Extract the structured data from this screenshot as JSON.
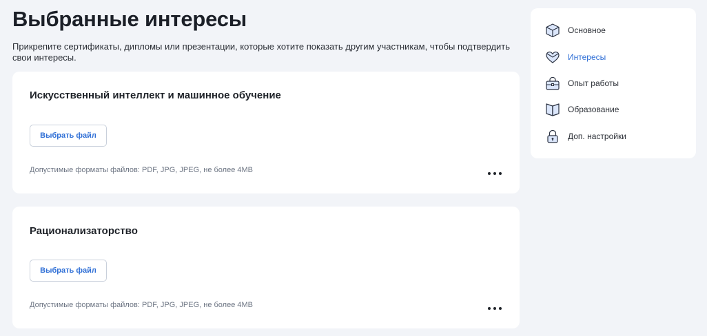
{
  "page": {
    "title": "Выбранные интересы",
    "description": "Прикрепите сертификаты, дипломы или презентации, которые хотите показать другим участникам, чтобы подтвердить свои интересы."
  },
  "cards": [
    {
      "title": "Искусственный интеллект и машинное обучение",
      "button_label": "Выбрать файл",
      "formats": "Допустимые форматы файлов: PDF, JPG, JPEG, не более 4MB"
    },
    {
      "title": "Рационализаторство",
      "button_label": "Выбрать файл",
      "formats": "Допустимые форматы файлов: PDF, JPG, JPEG, не более 4MB"
    }
  ],
  "sidebar": {
    "items": [
      {
        "label": "Основное",
        "icon": "cube-icon",
        "active": false
      },
      {
        "label": "Интересы",
        "icon": "heart-icon",
        "active": true
      },
      {
        "label": "Опыт работы",
        "icon": "briefcase-icon",
        "active": false
      },
      {
        "label": "Образование",
        "icon": "book-icon",
        "active": false
      },
      {
        "label": "Доп. настройки",
        "icon": "lock-icon",
        "active": false
      }
    ]
  },
  "colors": {
    "background": "#f2f4f8",
    "accent": "#2f6fd6",
    "icon_fill": "#dbe6fb",
    "icon_stroke": "#2a3140"
  }
}
